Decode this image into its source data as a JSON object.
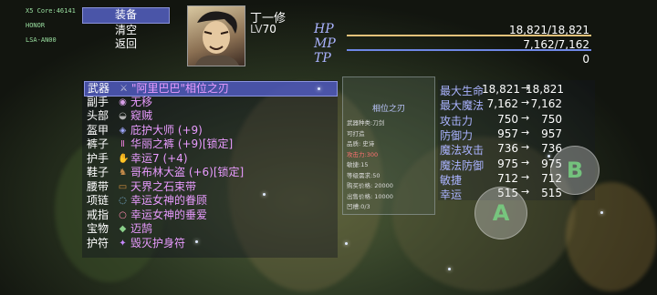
{
  "system_info": [
    "X5 Core:46141",
    "HONOR",
    "LSA-AN00"
  ],
  "menu": [
    {
      "label": "装备",
      "selected": true
    },
    {
      "label": "清空",
      "selected": false
    },
    {
      "label": "返回",
      "selected": false
    }
  ],
  "character": {
    "name": "丁一修",
    "level_prefix": "LV",
    "level": "70"
  },
  "stats": {
    "hp": {
      "label": "HP",
      "value": "18,821/18,821"
    },
    "mp": {
      "label": "MP",
      "value": "7,162/7,162"
    },
    "tp": {
      "label": "TP",
      "value": "0"
    }
  },
  "equipment": [
    {
      "slot": "武器",
      "item": "\"阿里巴巴\"相位之刃",
      "icon": "sword-icon",
      "selected": true
    },
    {
      "slot": "副手",
      "item": "无移",
      "icon": "orb-icon"
    },
    {
      "slot": "头部",
      "item": "窥贼",
      "icon": "helmet-icon"
    },
    {
      "slot": "盔甲",
      "item": "庇护大师 (+9)",
      "icon": "armor-icon"
    },
    {
      "slot": "裤子",
      "item": "华丽之裤 (+9)[锁定]",
      "icon": "pants-icon"
    },
    {
      "slot": "护手",
      "item": "幸运7 (+4)",
      "icon": "gauntlet-icon"
    },
    {
      "slot": "鞋子",
      "item": "哥布林大盗 (+6)[锁定]",
      "icon": "boots-icon"
    },
    {
      "slot": "腰带",
      "item": "天界之石束带",
      "icon": "belt-icon"
    },
    {
      "slot": "项链",
      "item": "幸运女神的眷顾",
      "icon": "necklace-icon"
    },
    {
      "slot": "戒指",
      "item": "幸运女神的垂爱",
      "icon": "ring-icon"
    },
    {
      "slot": "宝物",
      "item": "迈鹄",
      "icon": "treasure-icon"
    },
    {
      "slot": "护符",
      "item": "毁灭护身符",
      "icon": "amulet-icon"
    }
  ],
  "item_info": {
    "title": "相位之刃",
    "lines": [
      {
        "text": "武器种类:刀剑",
        "red": false
      },
      {
        "text": "可打造",
        "red": false
      },
      {
        "text": "品质: 史诗",
        "red": false
      },
      {
        "text": "攻击力:300",
        "red": true
      },
      {
        "text": "敏捷:15",
        "red": false
      },
      {
        "text": "等级需求:50",
        "red": false
      },
      {
        "text": "购买价格: 20000",
        "red": false
      },
      {
        "text": "出售价格: 10000",
        "red": false
      },
      {
        "text": "凹槽:0/3",
        "red": false
      }
    ]
  },
  "comparison": [
    {
      "label": "最大生命",
      "old": "18,821",
      "new": "18,821"
    },
    {
      "label": "最大魔法",
      "old": "7,162",
      "new": "7,162"
    },
    {
      "label": "攻击力",
      "old": "750",
      "new": "750"
    },
    {
      "label": "防御力",
      "old": "957",
      "new": "957"
    },
    {
      "label": "魔法攻击",
      "old": "736",
      "new": "736"
    },
    {
      "label": "魔法防御",
      "old": "975",
      "new": "975"
    },
    {
      "label": "敏捷",
      "old": "712",
      "new": "712"
    },
    {
      "label": "幸运",
      "old": "515",
      "new": "515"
    }
  ],
  "arrow": "→",
  "buttons": {
    "a_label": "A",
    "b_label": "B"
  },
  "colors": {
    "hp_bar": "#e4c27a",
    "mp_bar": "#6e87e6",
    "stat_label": "#aab3ff",
    "item_text": "#e99bff",
    "selection": "#4a55a8"
  }
}
